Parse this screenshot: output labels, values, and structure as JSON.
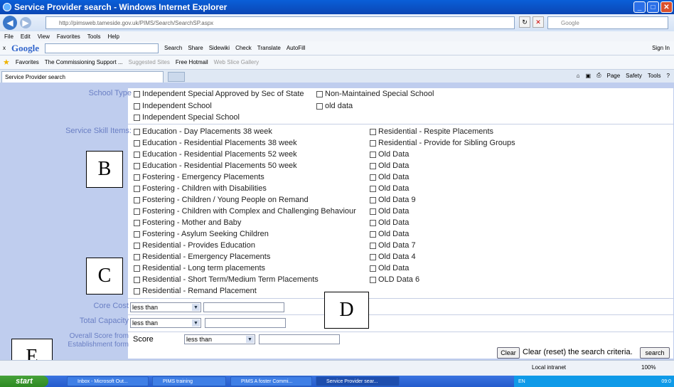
{
  "window": {
    "title": "Service Provider search - Windows Internet Explorer"
  },
  "address": {
    "url_domain": "http://pimsweb.tameside.gov.uk",
    "url_path": "/PIMS/Search/SearchSP.aspx",
    "google_placeholder": "Google"
  },
  "menu": [
    "File",
    "Edit",
    "View",
    "Favorites",
    "Tools",
    "Help"
  ],
  "google_toolbar": {
    "logo": "Google",
    "items": [
      "Search",
      "Share",
      "Sidewiki",
      "Check",
      "Translate",
      "AutoFill"
    ],
    "signin": "Sign In"
  },
  "favorites": {
    "label": "Favorites",
    "items": [
      "The Commissioning Support ...",
      "Suggested Sites",
      "Free Hotmail",
      "Web Slice Gallery"
    ]
  },
  "tab": {
    "label": "Service Provider search",
    "tools": [
      "Page",
      "Safety",
      "Tools"
    ]
  },
  "form": {
    "school_type_label": "School Type",
    "school_types": [
      "Independent Special Approved by Sec of State",
      "Non-Maintained Special School",
      "Independent School",
      "old data",
      "Independent Special School"
    ],
    "skill_label": "Service Skill Items:",
    "skills_left": [
      "Education - Day Placements 38 week",
      "Education - Residential Placements 38 week",
      "Education - Residential Placements 52 week",
      "Education - Residential Placements 50 week",
      "Fostering - Emergency Placements",
      "Fostering - Children with Disabilities",
      "Fostering - Children / Young People on Remand",
      "Fostering - Children with Complex and Challenging Behaviour",
      "Fostering - Mother and Baby",
      "Fostering - Asylum Seeking Children",
      "Residential - Provides Education",
      "Residential - Emergency Placements",
      "Residential - Long term placements",
      "Residential - Short Term/Medium Term Placements",
      "Residential - Remand Placement"
    ],
    "skills_right": [
      "Residential - Respite Placements",
      "Residential - Provide for Sibling Groups",
      "Old Data",
      "Old Data",
      "Old Data",
      "Old Data",
      "Old Data 9",
      "Old Data",
      "Old Data",
      "Old Data",
      "Old Data 7",
      "Old Data 4",
      "Old Data",
      "OLD Data 6"
    ],
    "core_cost_label": "Core Cost",
    "core_cost_op": "less than",
    "total_capacity_label": "Total Capacity",
    "total_capacity_op": "less than",
    "overall_label_1": "Overall Score from",
    "overall_label_2": "Establishment form",
    "score_label": "Score",
    "score_op": "less than",
    "clear_btn": "Clear",
    "clear_text": "Clear (reset) the search criteria.",
    "search_btn": "search"
  },
  "annotations": [
    "B",
    "C",
    "D",
    "E"
  ],
  "status": {
    "zone": "Local intranet",
    "zoom": "100%"
  },
  "taskbar": {
    "start": "start",
    "items": [
      "Inbox - Microsoft Out...",
      "PIMS training",
      "PIMS A foster Commi...",
      "Service Provider sear..."
    ],
    "tray_lang": "EN",
    "clock": "09:0"
  }
}
